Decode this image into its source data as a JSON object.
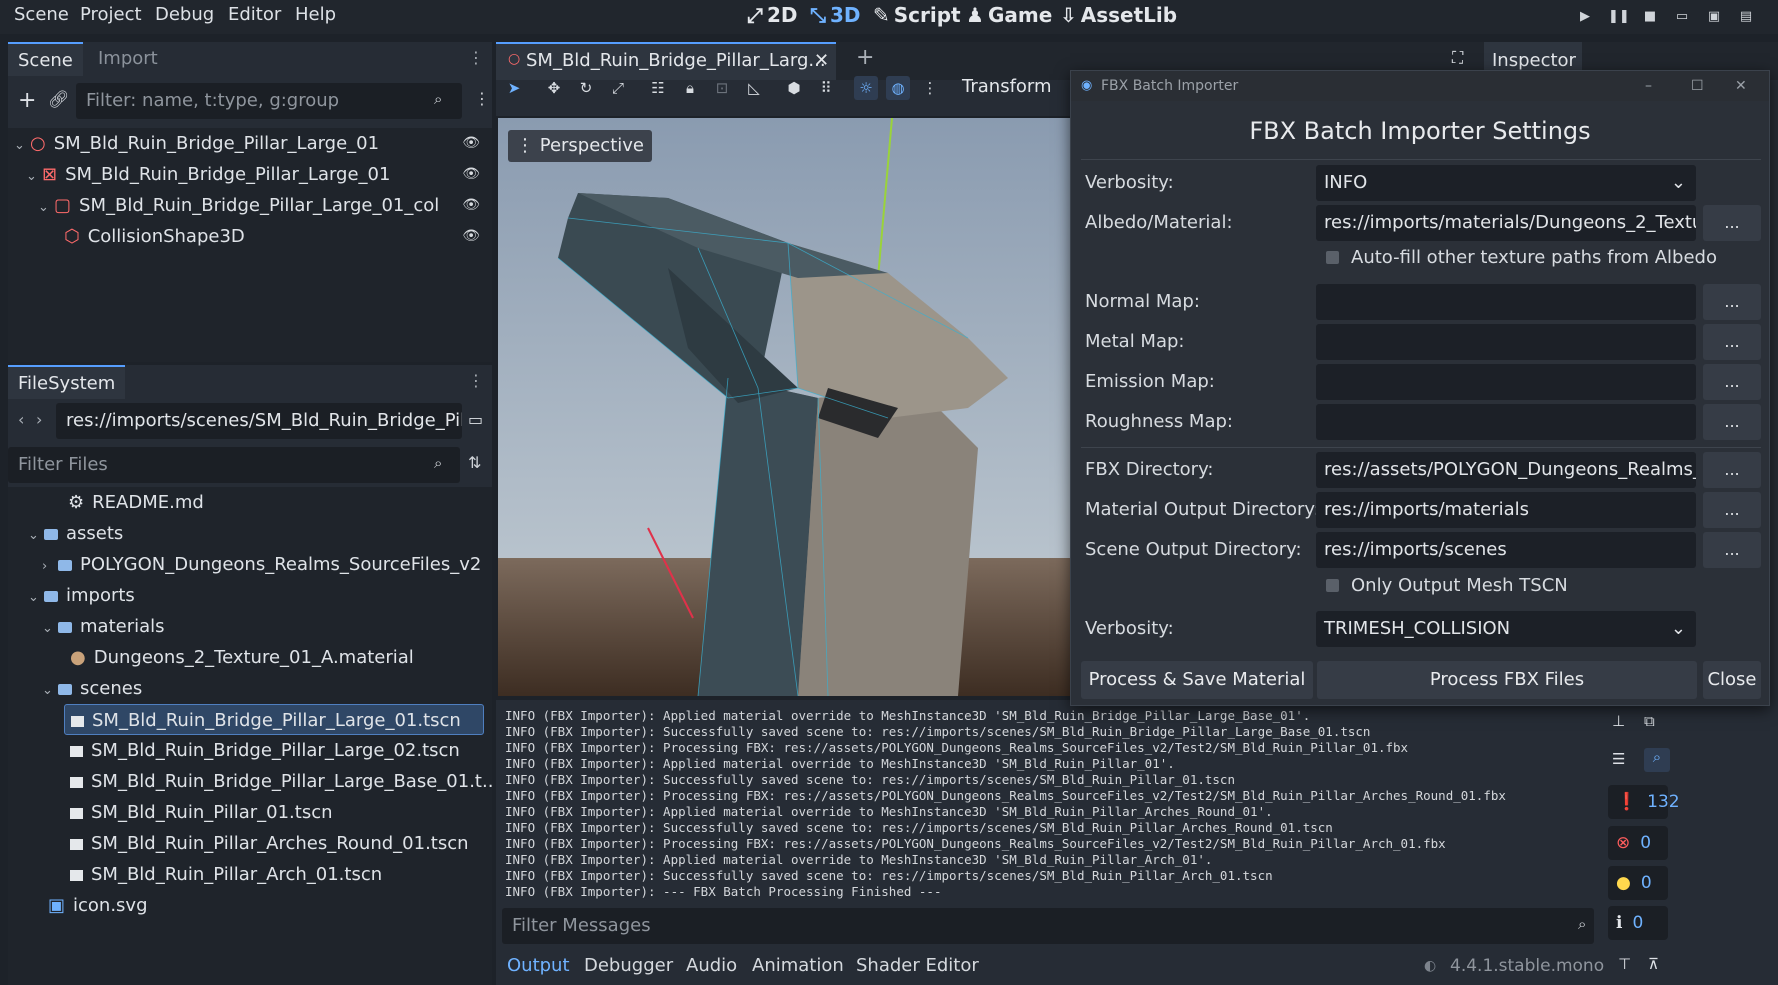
{
  "menubar": {
    "items": [
      "Scene",
      "Project",
      "Debug",
      "Editor",
      "Help"
    ],
    "workspaces": [
      {
        "label": "2D",
        "icon": "2d-icon"
      },
      {
        "label": "3D",
        "icon": "3d-icon",
        "active": true
      },
      {
        "label": "Script",
        "icon": "script-icon"
      },
      {
        "label": "Game",
        "icon": "game-icon"
      },
      {
        "label": "AssetLib",
        "icon": "assetlib-icon"
      }
    ]
  },
  "scene_dock": {
    "tabs": [
      "Scene",
      "Import"
    ],
    "filter_placeholder": "Filter: name, t:type, g:group",
    "tree": [
      "SM_Bld_Ruin_Bridge_Pillar_Large_01",
      "SM_Bld_Ruin_Bridge_Pillar_Large_01",
      "SM_Bld_Ruin_Bridge_Pillar_Large_01_col",
      "CollisionShape3D"
    ]
  },
  "filesystem": {
    "tab": "FileSystem",
    "path": "res://imports/scenes/SM_Bld_Ruin_Bridge_Pill",
    "filter_placeholder": "Filter Files",
    "items": [
      "README.md",
      "assets",
      "POLYGON_Dungeons_Realms_SourceFiles_v2",
      "imports",
      "materials",
      "Dungeons_2_Texture_01_A.material",
      "scenes",
      "SM_Bld_Ruin_Bridge_Pillar_Large_01.tscn",
      "SM_Bld_Ruin_Bridge_Pillar_Large_02.tscn",
      "SM_Bld_Ruin_Bridge_Pillar_Large_Base_01.t...",
      "SM_Bld_Ruin_Pillar_01.tscn",
      "SM_Bld_Ruin_Pillar_Arches_Round_01.tscn",
      "SM_Bld_Ruin_Pillar_Arch_01.tscn",
      "icon.svg"
    ]
  },
  "editor": {
    "scene_tab": "SM_Bld_Ruin_Bridge_Pillar_Larg...",
    "transform_label": "Transform",
    "viewport_label": "Perspective",
    "inspector_tab": "Inspector"
  },
  "output": {
    "lines": [
      "INFO (FBX Importer): Applied material override to MeshInstance3D 'SM_Bld_Ruin_Bridge_Pillar_Large_Base_01'.",
      "INFO (FBX Importer): Successfully saved scene to: res://imports/scenes/SM_Bld_Ruin_Bridge_Pillar_Large_Base_01.tscn",
      "INFO (FBX Importer): Processing FBX: res://assets/POLYGON_Dungeons_Realms_SourceFiles_v2/Test2/SM_Bld_Ruin_Pillar_01.fbx",
      "INFO (FBX Importer): Applied material override to MeshInstance3D 'SM_Bld_Ruin_Pillar_01'.",
      "INFO (FBX Importer): Successfully saved scene to: res://imports/scenes/SM_Bld_Ruin_Pillar_01.tscn",
      "INFO (FBX Importer): Processing FBX: res://assets/POLYGON_Dungeons_Realms_SourceFiles_v2/Test2/SM_Bld_Ruin_Pillar_Arches_Round_01.fbx",
      "INFO (FBX Importer): Applied material override to MeshInstance3D 'SM_Bld_Ruin_Pillar_Arches_Round_01'.",
      "INFO (FBX Importer): Successfully saved scene to: res://imports/scenes/SM_Bld_Ruin_Pillar_Arches_Round_01.tscn",
      "INFO (FBX Importer): Processing FBX: res://assets/POLYGON_Dungeons_Realms_SourceFiles_v2/Test2/SM_Bld_Ruin_Pillar_Arch_01.fbx",
      "INFO (FBX Importer): Applied material override to MeshInstance3D 'SM_Bld_Ruin_Pillar_Arch_01'.",
      "INFO (FBX Importer): Successfully saved scene to: res://imports/scenes/SM_Bld_Ruin_Pillar_Arch_01.tscn",
      "INFO (FBX Importer): --- FBX Batch Processing Finished ---"
    ],
    "filter_placeholder": "Filter Messages",
    "counts": {
      "messages": "132",
      "errors": "0",
      "warnings": "0",
      "info": "0"
    },
    "bottom_tabs": [
      "Output",
      "Debugger",
      "Audio",
      "Animation",
      "Shader Editor"
    ],
    "version": "4.4.1.stable.mono"
  },
  "dialog": {
    "window_title": "FBX Batch Importer",
    "heading": "FBX Batch Importer Settings",
    "verbosity_label": "Verbosity:",
    "verbosity_value": "INFO",
    "albedo_label": "Albedo/Material:",
    "albedo_value": "res://imports/materials/Dungeons_2_Textu",
    "autofill_label": "Auto-fill other texture paths from Albedo",
    "normal_label": "Normal Map:",
    "metal_label": "Metal Map:",
    "emission_label": "Emission Map:",
    "roughness_label": "Roughness Map:",
    "fbx_dir_label": "FBX Directory:",
    "fbx_dir_value": "res://assets/POLYGON_Dungeons_Realms_",
    "mat_out_label": "Material Output Directory:",
    "mat_out_value": "res://imports/materials",
    "scene_out_label": "Scene Output Directory:",
    "scene_out_value": "res://imports/scenes",
    "only_mesh_label": "Only Output Mesh TSCN",
    "verbosity2_label": "Verbosity:",
    "verbosity2_value": "TRIMESH_COLLISION",
    "dots": "...",
    "btn_process_material": "Process & Save Material",
    "btn_process_fbx": "Process FBX Files",
    "btn_close": "Close"
  },
  "colors": {
    "accent": "#569eff",
    "selection": "#2f4766"
  }
}
